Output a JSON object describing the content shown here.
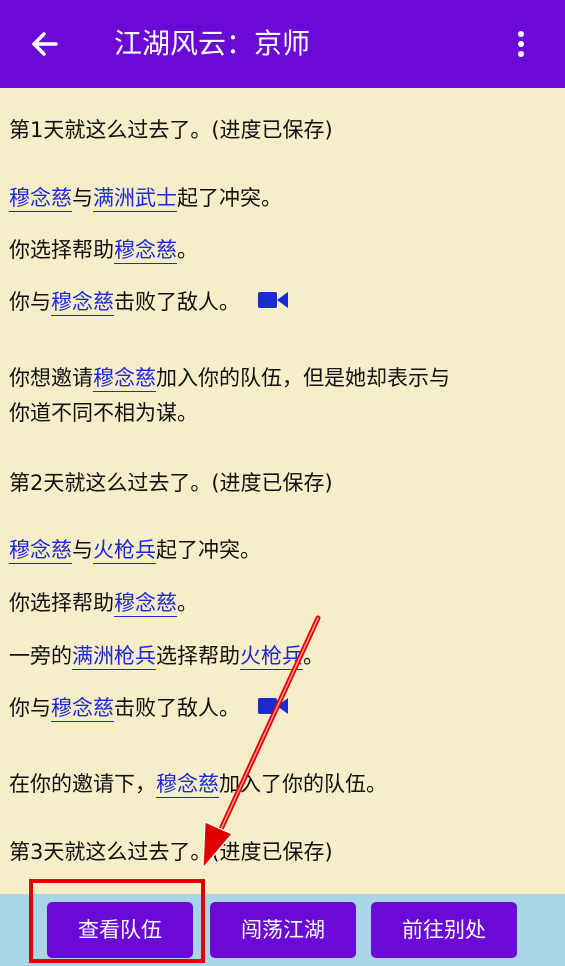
{
  "appbar": {
    "title": "江湖风云：京师",
    "back_icon": "arrow-left-icon",
    "more_icon": "more-vertical-icon"
  },
  "log": {
    "day1": "第1天就这么过去了。(进度已保存)",
    "l2": {
      "a": "穆念慈",
      "b": "与",
      "c": "满洲武士",
      "d": "起了冲突。"
    },
    "l3": {
      "a": "你选择帮助",
      "b": "穆念慈",
      "c": "。"
    },
    "l4": {
      "a": "你与",
      "b": "穆念慈",
      "c": "击败了敌人。"
    },
    "l5a": {
      "a": "你想邀请",
      "b": "穆念慈",
      "c": "加入你的队伍，但是她却表示与"
    },
    "l5b": "你道不同不相为谋。",
    "day2": "第2天就这么过去了。(进度已保存)",
    "l7": {
      "a": "穆念慈",
      "b": "与",
      "c": "火枪兵",
      "d": "起了冲突。"
    },
    "l8": {
      "a": "你选择帮助",
      "b": "穆念慈",
      "c": "。"
    },
    "l9": {
      "a": "一旁的",
      "b": "满洲枪兵",
      "c": "选择帮助",
      "d": "火枪兵",
      "e": "。"
    },
    "l10": {
      "a": "你与",
      "b": "穆念慈",
      "c": "击败了敌人。"
    },
    "l11": {
      "a": "在你的邀请下，",
      "b": "穆念慈",
      "c": "加入了你的队伍。"
    },
    "day3": "第3天就这么过去了。(进度已保存)"
  },
  "bottom": {
    "view_team": "查看队伍",
    "roam": "闯荡江湖",
    "go_elsewhere": "前往别处"
  },
  "colors": {
    "appbar": "#6b0ad6",
    "background": "#f7eec9",
    "link": "#1b2ad3",
    "bottombar": "#a9d6e6",
    "annotation": "#e00000"
  }
}
